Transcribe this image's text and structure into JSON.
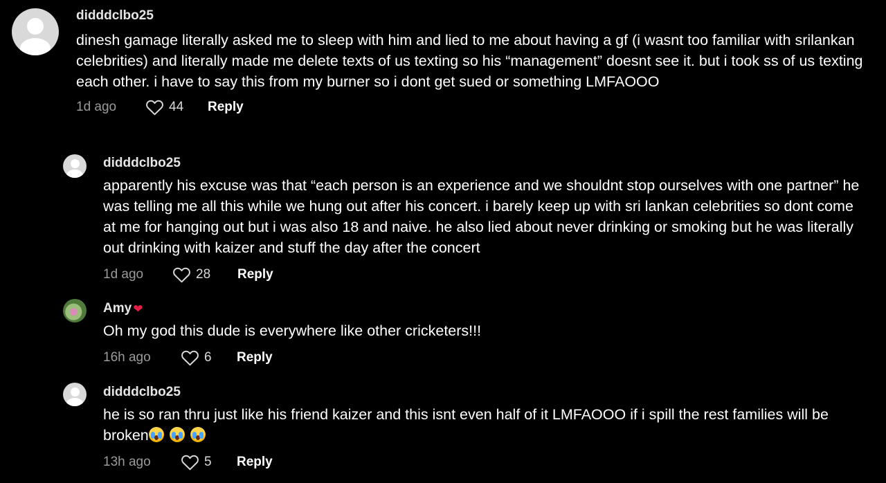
{
  "comments": [
    {
      "username": "didddclbo25",
      "text": "dinesh gamage literally asked me to sleep with him and lied to me about having a gf (i wasnt too familiar with srilankan celebrities) and literally made me delete texts of us texting so his “management” doesnt see it. but i took ss of us texting each other. i have to say this from my burner so i dont get sued or something LMFAOOO",
      "time": "1d ago",
      "likes": "44",
      "reply_label": "Reply",
      "avatar": "default-avatar"
    },
    {
      "username": "didddclbo25",
      "text": "apparently his excuse was that “each person is an experience and we shouldnt stop ourselves with one partner” he was telling me all this while we hung out after his concert. i barely keep up with sri lankan celebrities so dont come at me for hanging out but i was also 18 and naive. he also lied about never drinking or smoking but he was literally out drinking with kaizer and stuff the day after the concert",
      "time": "1d ago",
      "likes": "28",
      "reply_label": "Reply",
      "avatar": "default-avatar"
    },
    {
      "username": "Amy",
      "badge": "❤",
      "text": "Oh my god this dude is everywhere like other cricketers!!!",
      "time": "16h ago",
      "likes": "6",
      "reply_label": "Reply",
      "avatar": "photo-avatar"
    },
    {
      "username": "didddclbo25",
      "text": "he is so ran thru just like his friend kaizer and this isnt even half of it LMFAOOO if i spill the rest families will be broken",
      "emojis": [
        "loudly-crying-face-emoji",
        "loudly-crying-face-emoji",
        "loudly-crying-face-emoji"
      ],
      "time": "13h ago",
      "likes": "5",
      "reply_label": "Reply",
      "avatar": "default-avatar"
    }
  ],
  "colors": {
    "background": "#000000",
    "text": "#ffffff",
    "muted": "#9a9a9a",
    "badge": "#e11d48"
  },
  "icons": {
    "like": "heart-outline-icon",
    "avatar": "default-user-avatar-icon"
  }
}
